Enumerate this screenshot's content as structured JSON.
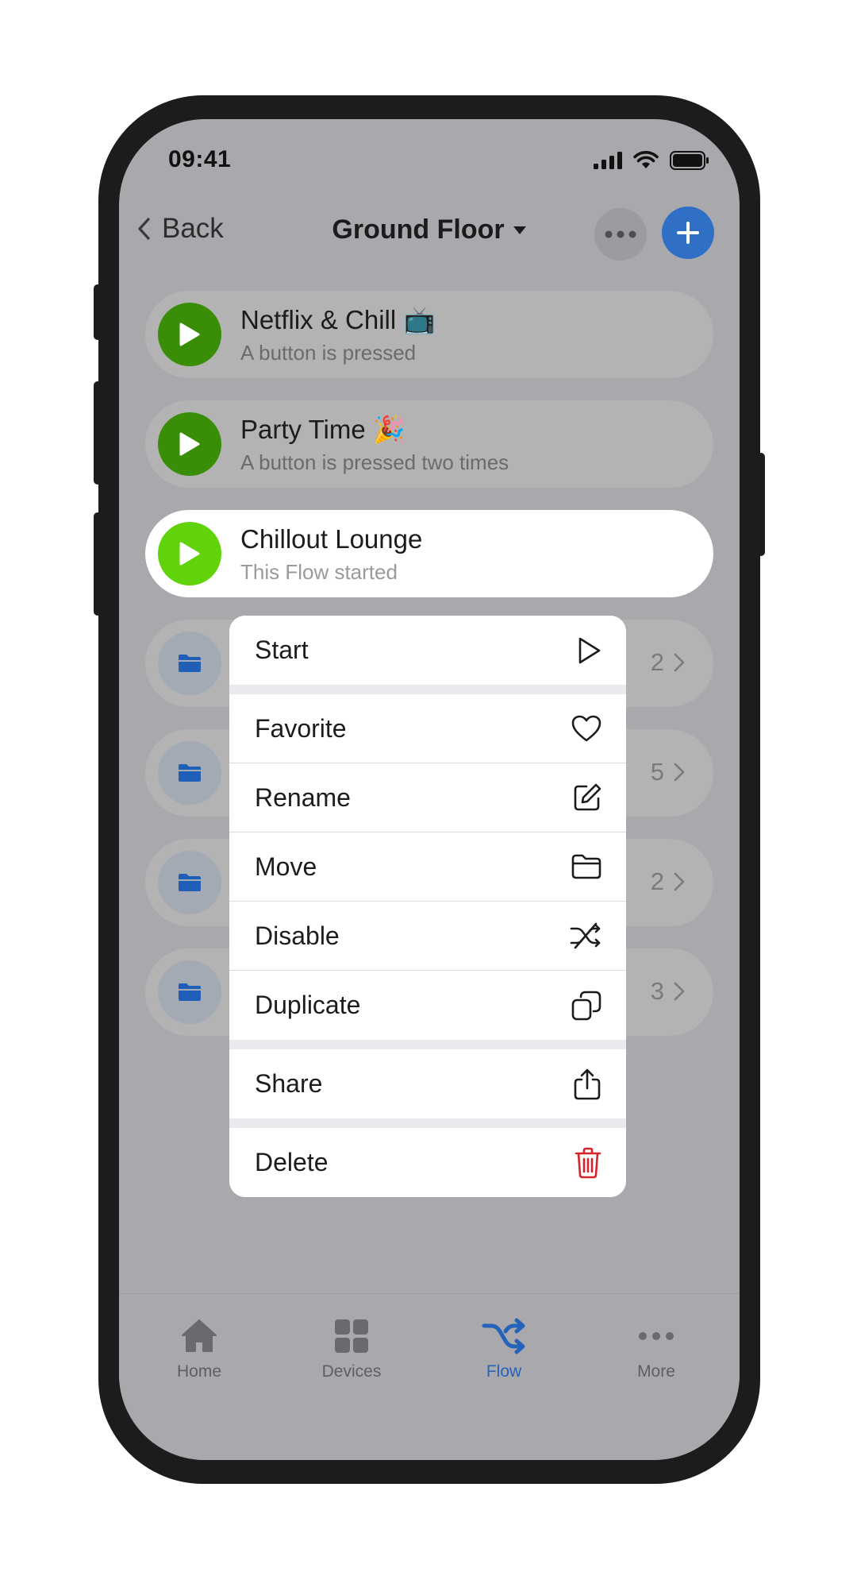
{
  "status": {
    "time": "09:41"
  },
  "header": {
    "back_label": "Back",
    "title": "Ground Floor"
  },
  "flows": [
    {
      "name": "Netflix & Chill 📺",
      "description": "A button is pressed"
    },
    {
      "name": "Party Time 🎉",
      "description": "A button is pressed two times"
    },
    {
      "name": "Chillout Lounge",
      "description": "This Flow started"
    }
  ],
  "folders": [
    {
      "count": "2"
    },
    {
      "count": "5"
    },
    {
      "count": "2"
    },
    {
      "count": "3"
    }
  ],
  "menu": {
    "start": "Start",
    "favorite": "Favorite",
    "rename": "Rename",
    "move": "Move",
    "disable": "Disable",
    "duplicate": "Duplicate",
    "share": "Share",
    "delete": "Delete"
  },
  "tabs": [
    {
      "label": "Home",
      "icon": "home-icon"
    },
    {
      "label": "Devices",
      "icon": "grid-icon"
    },
    {
      "label": "Flow",
      "icon": "shuffle-icon"
    },
    {
      "label": "More",
      "icon": "dots-icon"
    }
  ],
  "colors": {
    "accent": "#2563b8",
    "play_green": "#3a8e07",
    "play_green_active": "#60d30a",
    "delete_red": "#d8232a"
  }
}
